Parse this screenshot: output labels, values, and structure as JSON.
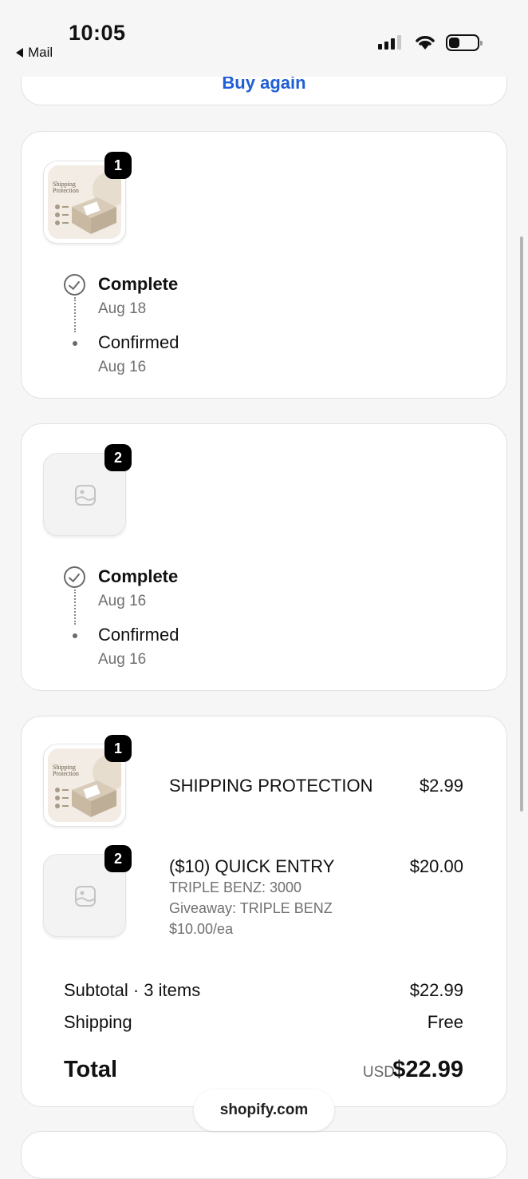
{
  "status": {
    "time": "10:05",
    "back_label": "Mail"
  },
  "buy_again_label": "Buy again",
  "fulfillments": [
    {
      "quantity": "1",
      "image_label": "Shipping Protection",
      "events": [
        {
          "title": "Complete",
          "date": "Aug 18"
        },
        {
          "title": "Confirmed",
          "date": "Aug 16"
        }
      ]
    },
    {
      "quantity": "2",
      "events": [
        {
          "title": "Complete",
          "date": "Aug 16"
        },
        {
          "title": "Confirmed",
          "date": "Aug 16"
        }
      ]
    }
  ],
  "order": {
    "items": [
      {
        "quantity": "1",
        "image_label": "Shipping Protection",
        "title": "SHIPPING PROTECTION",
        "price": "$2.99"
      },
      {
        "quantity": "2",
        "title": "($10) QUICK ENTRY",
        "price": "$20.00",
        "details": [
          "TRIPLE BENZ: 3000",
          "Giveaway: TRIPLE BENZ",
          "$10.00/ea"
        ]
      }
    ],
    "subtotal_label": "Subtotal · 3 items",
    "subtotal_value": "$22.99",
    "shipping_label": "Shipping",
    "shipping_value": "Free",
    "total_label": "Total",
    "total_currency": "USD",
    "total_value": "$22.99"
  },
  "footer_label": "shopify.com",
  "colors": {
    "link": "#1f5fd6",
    "background": "#f6f6f7"
  }
}
